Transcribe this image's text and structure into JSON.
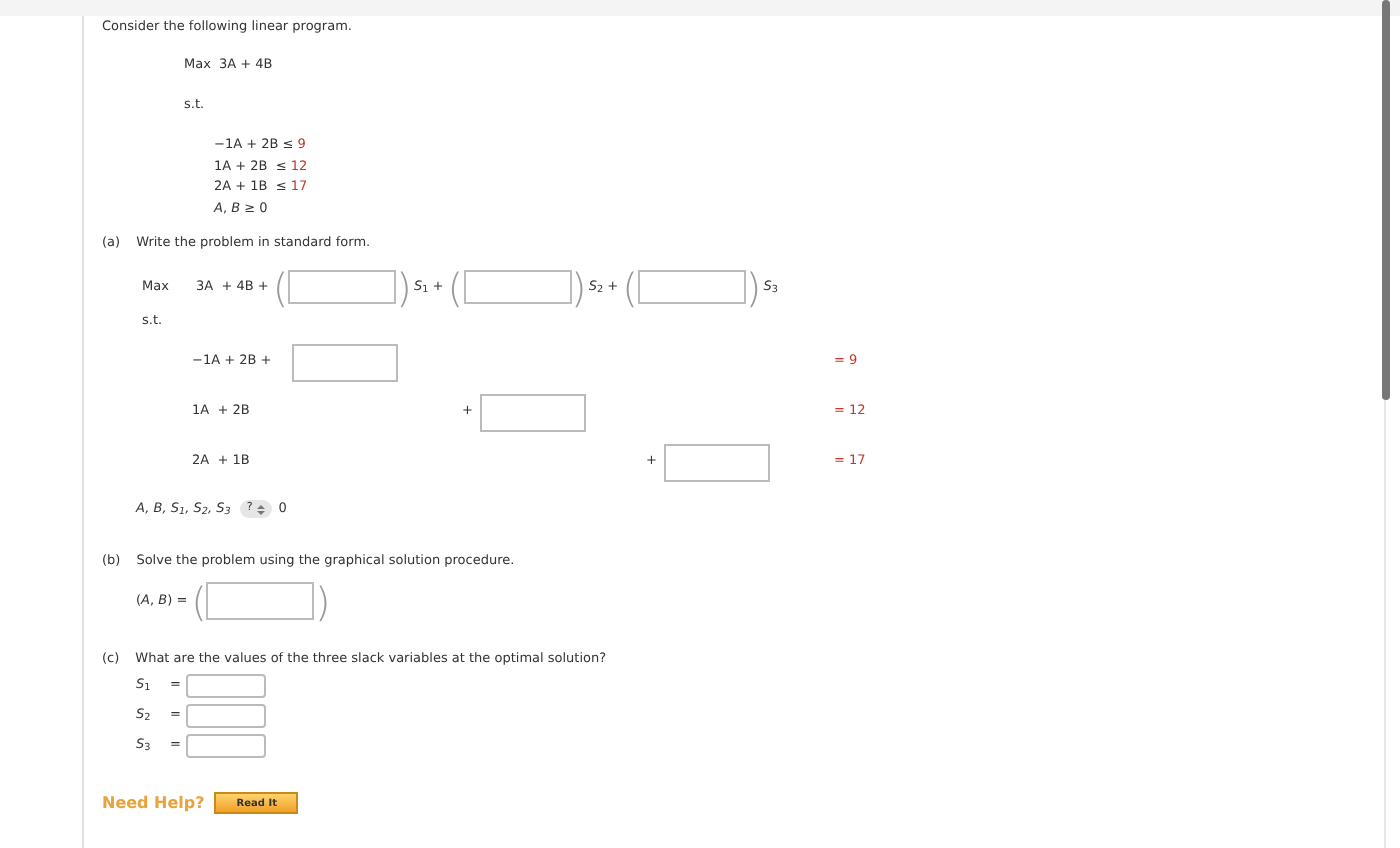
{
  "intro": "Consider the following linear program.",
  "problem": {
    "objective_label": "Max",
    "objective": "3A + 4B",
    "st_label": "s.t.",
    "constraints": [
      {
        "lhs": "−1A + 2B ≤",
        "rhs": "9"
      },
      {
        "lhs": "1A + 2B  ≤",
        "rhs": "12"
      },
      {
        "lhs": "2A + 1B  ≤",
        "rhs": "17"
      }
    ],
    "nonneg": "*A*, *B* ≥ 0"
  },
  "part_a": {
    "label": "(a)",
    "prompt": "Write the problem in standard form.",
    "objective_label": "Max",
    "objective": "3A  + 4B +",
    "slack_terms": [
      {
        "open": "(",
        "close": ")",
        "var": "*S*$_{1}$ +"
      },
      {
        "open": "(",
        "close": ")",
        "var": "*S*$_{2}$ +"
      },
      {
        "open": "(",
        "close": ")",
        "var": "*S*$_{3}$"
      }
    ],
    "st_label": "s.t.",
    "rows": [
      {
        "lhs": "−1A + 2B +",
        "rhs": "= 9"
      },
      {
        "lhs": "1A  + 2B",
        "plus": "+",
        "rhs": "= 12"
      },
      {
        "lhs": "2A  + 1B",
        "plus": "+",
        "rhs": "= 17"
      }
    ],
    "nonneg": {
      "vars": "*A*, *B*, *S*$_{1}$, *S*$_{2}$, *S*$_{3}$",
      "select_value": "?",
      "rhs": "0"
    }
  },
  "part_b": {
    "label": "(b)",
    "prompt": "Solve the problem using the graphical solution procedure.",
    "answer_label": "(*A*, *B*) =",
    "open": "(",
    "close": ")"
  },
  "part_c": {
    "label": "(c)",
    "prompt": "What are the values of the three slack variables at the optimal solution?",
    "answers": [
      {
        "label": "*S*$_{1}$",
        "eq": "="
      },
      {
        "label": "*S*$_{2}$",
        "eq": "="
      },
      {
        "label": "*S*$_{3}$",
        "eq": "="
      }
    ]
  },
  "help": {
    "label": "Need Help?",
    "button": "Read It"
  }
}
